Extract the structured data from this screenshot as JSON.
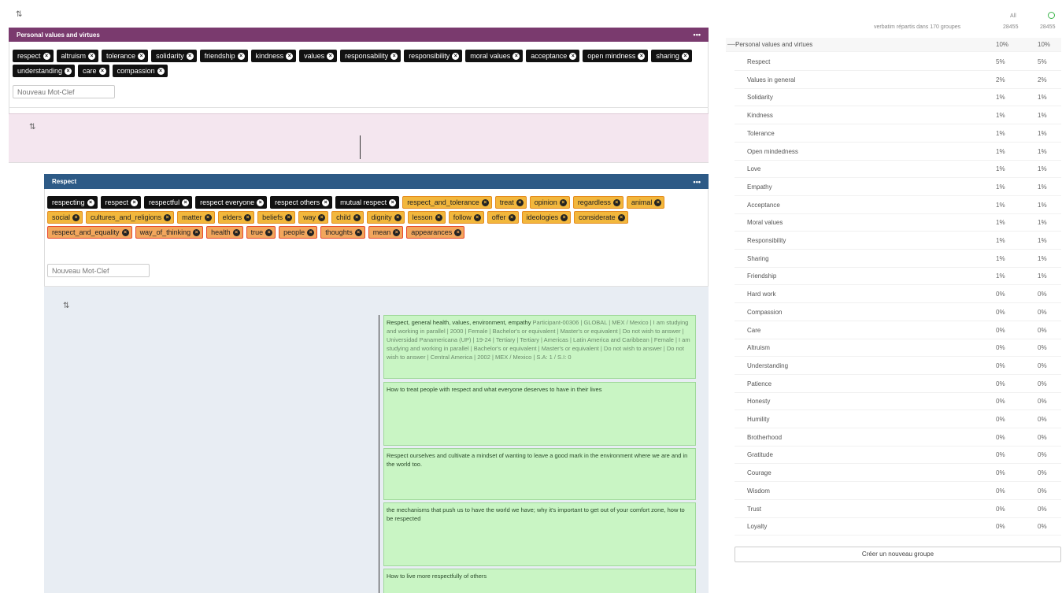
{
  "colors": {
    "group_purple": "#7a3a6e",
    "group_blue": "#2d5a86",
    "card_green": "#c9f5c4",
    "tag_orange": "#f2b73c",
    "tag_red_border": "#e8472b"
  },
  "group1": {
    "title": "Personal values and virtues",
    "menu": "•••",
    "tags": [
      "respect",
      "altruism",
      "tolerance",
      "solidarity",
      "friendship",
      "kindness",
      "values",
      "responsability",
      "responsibility",
      "moral values",
      "acceptance",
      "open mindness",
      "sharing",
      "understanding",
      "care",
      "compassion"
    ],
    "placeholder": "Nouveau Mot-Clef"
  },
  "group2": {
    "title": "Respect",
    "menu": "•••",
    "tags_black": [
      "respecting",
      "respect",
      "respectful",
      "respect everyone",
      "respect others",
      "mutual respect"
    ],
    "tags_orange": [
      "respect_and_tolerance",
      "treat",
      "opinion",
      "regardless",
      "animal",
      "social",
      "cultures_and_religions",
      "matter",
      "elders",
      "beliefs",
      "way",
      "child",
      "dignity",
      "lesson",
      "follow",
      "offer",
      "ideologies",
      "considerate"
    ],
    "tags_red": [
      "respect_and_equality",
      "way_of_thinking",
      "health",
      "true",
      "people",
      "thoughts",
      "mean",
      "appearances"
    ],
    "placeholder": "Nouveau Mot-Clef"
  },
  "cards": [
    {
      "title": "Respect, general health, values, environment, empathy",
      "meta": "Participant-00306 | GLOBAL | MEX / Mexico | I am studying and working in parallel | 2000 | Female | Bachelor's or equivalent | Master's or equivalent | Do not wish to answer | Universidad Panamericana (UP) | 19-24 | Tertiary | Tertiary | Americas | Latin America and Caribbean | Female | I am studying and working in parallel | Bachelor's or equivalent | Master's or equivalent | Do not wish to answer | Do not wish to answer | Central America | 2002 | MEX / Mexico | S.A: 1 / S.I: 0"
    },
    {
      "title": "How to treat people with respect and what everyone deserves to have in their lives",
      "meta": ""
    },
    {
      "title": "Respect ourselves and cultivate a mindset of wanting to leave a good mark in the environment where we are and in the world too.",
      "meta": ""
    },
    {
      "title": "the mechanisms that push us to have the world we have; why it's important to get out of your comfort zone, how to be respected",
      "meta": ""
    },
    {
      "title": "How to live more respectfully of others",
      "meta": ""
    }
  ],
  "right_panel": {
    "subtitle": "verbatim répartis dans 170 groupes",
    "col_all": "All",
    "col_all_count": "28455",
    "col_check_count": "28455",
    "group_label": "Personal values and virtues",
    "group_all": "10%",
    "group_check": "10%",
    "rows": [
      {
        "label": "Respect",
        "all": "5%",
        "chk": "5%"
      },
      {
        "label": "Values in general",
        "all": "2%",
        "chk": "2%"
      },
      {
        "label": "Solidarity",
        "all": "1%",
        "chk": "1%"
      },
      {
        "label": "Kindness",
        "all": "1%",
        "chk": "1%"
      },
      {
        "label": "Tolerance",
        "all": "1%",
        "chk": "1%"
      },
      {
        "label": "Open mindedness",
        "all": "1%",
        "chk": "1%"
      },
      {
        "label": "Love",
        "all": "1%",
        "chk": "1%"
      },
      {
        "label": "Empathy",
        "all": "1%",
        "chk": "1%"
      },
      {
        "label": "Acceptance",
        "all": "1%",
        "chk": "1%"
      },
      {
        "label": "Moral values",
        "all": "1%",
        "chk": "1%"
      },
      {
        "label": "Responsibility",
        "all": "1%",
        "chk": "1%"
      },
      {
        "label": "Sharing",
        "all": "1%",
        "chk": "1%"
      },
      {
        "label": "Friendship",
        "all": "1%",
        "chk": "1%"
      },
      {
        "label": "Hard work",
        "all": "0%",
        "chk": "0%"
      },
      {
        "label": "Compassion",
        "all": "0%",
        "chk": "0%"
      },
      {
        "label": "Care",
        "all": "0%",
        "chk": "0%"
      },
      {
        "label": "Altruism",
        "all": "0%",
        "chk": "0%"
      },
      {
        "label": "Understanding",
        "all": "0%",
        "chk": "0%"
      },
      {
        "label": "Patience",
        "all": "0%",
        "chk": "0%"
      },
      {
        "label": "Honesty",
        "all": "0%",
        "chk": "0%"
      },
      {
        "label": "Humility",
        "all": "0%",
        "chk": "0%"
      },
      {
        "label": "Brotherhood",
        "all": "0%",
        "chk": "0%"
      },
      {
        "label": "Gratitude",
        "all": "0%",
        "chk": "0%"
      },
      {
        "label": "Courage",
        "all": "0%",
        "chk": "0%"
      },
      {
        "label": "Wisdom",
        "all": "0%",
        "chk": "0%"
      },
      {
        "label": "Trust",
        "all": "0%",
        "chk": "0%"
      },
      {
        "label": "Loyalty",
        "all": "0%",
        "chk": "0%"
      }
    ],
    "create_label": "Créer un nouveau groupe"
  }
}
